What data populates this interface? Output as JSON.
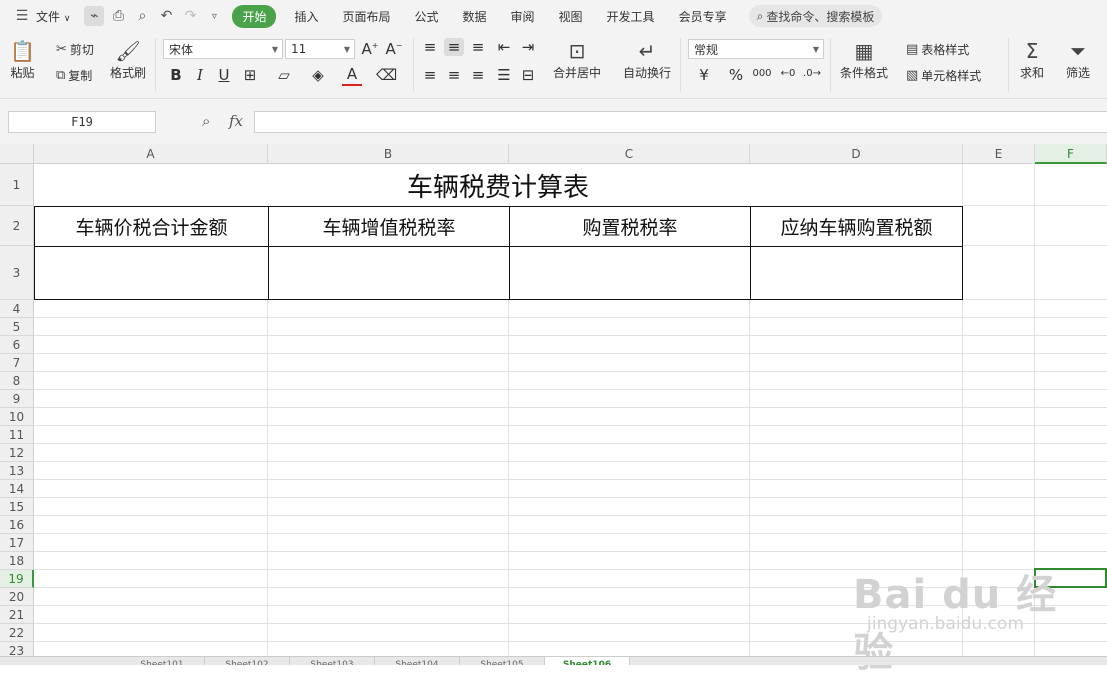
{
  "menubar": {
    "file_label": "文件",
    "tabs": [
      {
        "label": "开始",
        "active": true
      },
      {
        "label": "插入"
      },
      {
        "label": "页面布局"
      },
      {
        "label": "公式"
      },
      {
        "label": "数据"
      },
      {
        "label": "审阅"
      },
      {
        "label": "视图"
      },
      {
        "label": "开发工具"
      },
      {
        "label": "会员专享"
      }
    ],
    "search_label": "查找命令、搜索模板"
  },
  "ribbon": {
    "paste": "粘贴",
    "cut": "剪切",
    "copy": "复制",
    "format_painter": "格式刷",
    "font_name": "宋体",
    "font_size": "11",
    "merge_center": "合并居中",
    "wrap_text": "自动换行",
    "number_format": "常规",
    "currency": "¥",
    "percent": "%",
    "thousands": "000",
    "conditional_format": "条件格式",
    "table_style": "表格样式",
    "cell_style": "单元格样式",
    "sum": "求和",
    "filter": "筛选"
  },
  "formula_bar": {
    "name_box": "F19",
    "fx": "fx",
    "content": ""
  },
  "columns": [
    "A",
    "B",
    "C",
    "D",
    "E",
    "F"
  ],
  "rows": [
    "1",
    "2",
    "3",
    "4",
    "5",
    "6",
    "7",
    "8",
    "9",
    "10",
    "11",
    "12",
    "13",
    "14",
    "15",
    "16",
    "17",
    "18",
    "19",
    "20",
    "21",
    "22",
    "23"
  ],
  "sheet": {
    "title": "车辆税费计算表",
    "headers": [
      "车辆价税合计金额",
      "车辆增值税税率",
      "购置税税率",
      "应纳车辆购置税额"
    ],
    "values": [
      "",
      "",
      "",
      ""
    ]
  },
  "sheet_tabs": [
    "Sheet101",
    "Sheet102",
    "Sheet103",
    "Sheet104",
    "Sheet105",
    "Sheet106"
  ],
  "active_cell": "F19",
  "watermark": {
    "main": "Bai du 经验",
    "sub": "jingyan.baidu.com"
  },
  "colors": {
    "accent": "#4aa34a",
    "selection": "#2e8b2e"
  }
}
